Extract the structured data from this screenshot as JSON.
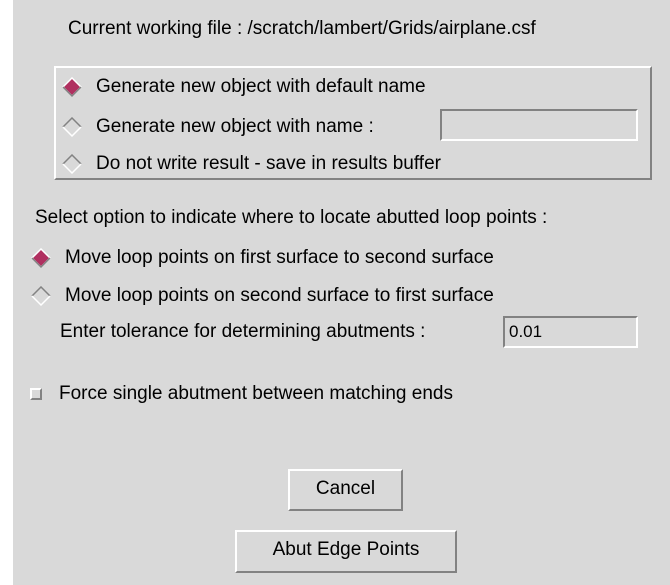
{
  "header": {
    "current_file_label": "Current working file : /scratch/lambert/Grids/airplane.csf"
  },
  "output_group": {
    "options": [
      {
        "label": "Generate new object with default name",
        "selected": true
      },
      {
        "label": "Generate new object with name :",
        "selected": false
      },
      {
        "label": "Do not write result - save in results buffer",
        "selected": false
      }
    ],
    "name_field_value": ""
  },
  "locate": {
    "prompt": "Select option to indicate where to  locate abutted loop points :",
    "options": [
      {
        "label": "Move loop points on first surface to second surface",
        "selected": true
      },
      {
        "label": "Move loop points on second surface to first surface",
        "selected": false
      }
    ]
  },
  "tolerance": {
    "label": "Enter tolerance for determining abutments :",
    "value": "0.01"
  },
  "force_single": {
    "label": "Force single abutment between matching ends",
    "checked": false
  },
  "buttons": {
    "cancel_label": "Cancel",
    "abut_label": "Abut Edge Points"
  },
  "colors": {
    "background": "#d9d9d9",
    "radio_selected": "#b03060",
    "bevel_light": "#ffffff",
    "bevel_dark": "#828282"
  }
}
